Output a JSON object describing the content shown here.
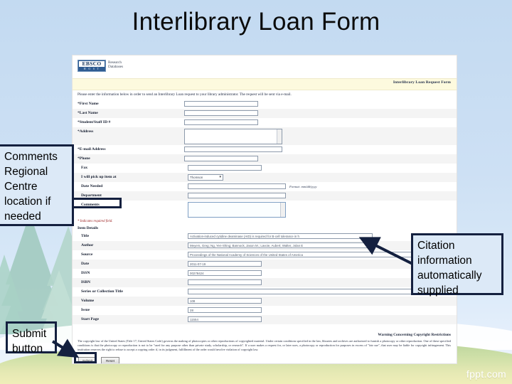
{
  "slide": {
    "title": "Interlibrary Loan Form",
    "watermark": "fppt.com"
  },
  "form": {
    "logo": {
      "brand": "EBSCO",
      "host": "H O S T",
      "tagline_line1": "Research",
      "tagline_line2": "Databases"
    },
    "banner_title": "Interlibrary Loan Request Form",
    "intro": "Please enter the information below in order to send an Interlibrary Loan request to your library administrator. The request will be sent via e-mail.",
    "required_note": "* Indicates required field.",
    "section_item_details": "Item Details",
    "date_format_hint": "Format: mm/dd/yyyy",
    "pickup_selected": "Thomson",
    "fields": [
      {
        "label": "First Name",
        "required": true,
        "indent": false,
        "type": "text",
        "size": "w-sm",
        "value": ""
      },
      {
        "label": "Last Name",
        "required": true,
        "indent": false,
        "type": "text",
        "size": "w-sm",
        "value": ""
      },
      {
        "label": "Student/Staff ID #",
        "required": true,
        "indent": false,
        "type": "text",
        "size": "w-sm",
        "value": ""
      },
      {
        "label": "Address",
        "required": true,
        "indent": false,
        "type": "textarea",
        "size": "",
        "value": ""
      },
      {
        "label": "E-mail Address",
        "required": true,
        "indent": false,
        "type": "text",
        "size": "w-md",
        "value": ""
      },
      {
        "label": "Phone",
        "required": true,
        "indent": false,
        "type": "text",
        "size": "w-sm",
        "value": ""
      },
      {
        "label": "Fax",
        "required": false,
        "indent": true,
        "type": "text",
        "size": "w-sm",
        "value": ""
      },
      {
        "label": "I will pick up item at",
        "required": false,
        "indent": true,
        "type": "select",
        "size": "",
        "value": "Thomson"
      },
      {
        "label": "Date Needed",
        "required": false,
        "indent": true,
        "type": "text-hint",
        "size": "w-md",
        "value": ""
      },
      {
        "label": "Department",
        "required": false,
        "indent": true,
        "type": "text",
        "size": "w-md",
        "value": ""
      },
      {
        "label": "Comments",
        "required": false,
        "indent": true,
        "type": "textarea-comments",
        "size": "",
        "value": ""
      }
    ],
    "item_fields": [
      {
        "label": "Title",
        "indent": true,
        "type": "text",
        "size": "w-xl",
        "value": "Activation-induced cytidine deaminase (AID) is required for B-cell tolerance in h"
      },
      {
        "label": "Author",
        "indent": true,
        "type": "text",
        "size": "w-xl",
        "value": "Meyers, Greg; Ng, Yen-Shing; Bannock, Jason M.; Lavoie, Aubert; Walter, Jolan E"
      },
      {
        "label": "Source",
        "indent": true,
        "type": "text",
        "size": "w-full",
        "value": "Proceedings of the National Academy of Sciences of the United States of America"
      },
      {
        "label": "Date",
        "indent": true,
        "type": "text",
        "size": "w-sm",
        "value": "2011-07-19"
      },
      {
        "label": "ISSN",
        "indent": true,
        "type": "text",
        "size": "w-sm",
        "value": "00278424"
      },
      {
        "label": "ISBN",
        "indent": true,
        "type": "text",
        "size": "w-sm",
        "value": ""
      },
      {
        "label": "Series or Collection Title",
        "indent": true,
        "type": "text",
        "size": "w-full",
        "value": ""
      },
      {
        "label": "Volume",
        "indent": true,
        "type": "text",
        "size": "w-sm",
        "value": "108"
      },
      {
        "label": "Issue",
        "indent": true,
        "type": "text",
        "size": "w-sm",
        "value": "28"
      },
      {
        "label": "Start Page",
        "indent": true,
        "type": "text",
        "size": "w-sm",
        "value": "11554"
      }
    ],
    "copyright_heading": "Warning Concerning Copyright Restrictions",
    "copyright_text": "The copyright law of the United States (Title 17, United States Code) governs the making of photocopies or other reproductions of copyrighted material. Under certain conditions specified in the law, libraries and archives are authorized to furnish a photocopy or other reproduction. One of these specified conditions is that the photocopy or reproduction is not to be \"used for any purpose other than private study, scholarship, or research\". If a user makes a request for, or later uses, a photocopy or reproduction for purposes in excess of \"fair use\", that user may be liable for copyright infringement. This institution reserves the right to refuse to accept a copying order if, in its judgment, fulfillment of the order would involve violation of copyright law.",
    "submit_label": "Submit",
    "reset_label": "Reset"
  },
  "annotations": {
    "comments": "Comments Regional Centre location if needed",
    "citation": "Citation information automatically supplied",
    "submit": "Submit button"
  }
}
